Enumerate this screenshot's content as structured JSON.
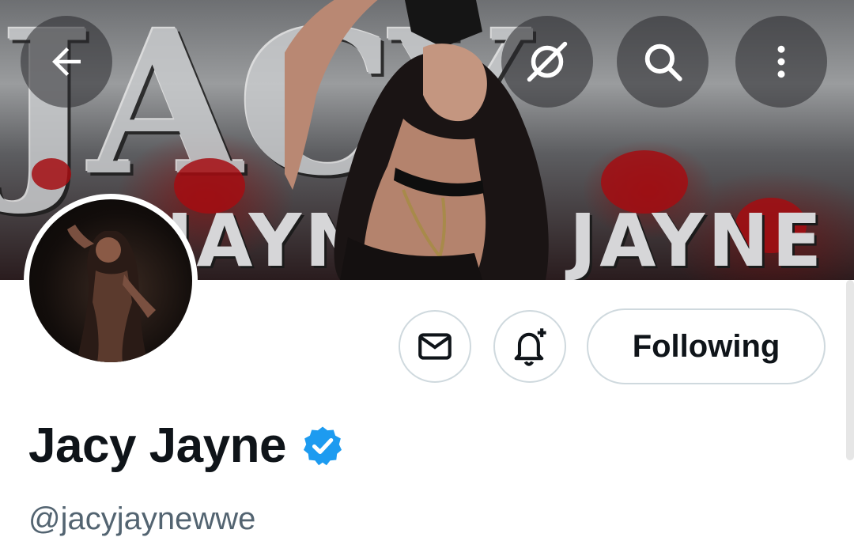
{
  "banner": {
    "letters": "JACY",
    "sub_left": "JAYNE",
    "sub_right": "JAYNE"
  },
  "topbar": {
    "back_icon": "arrow-left-icon",
    "grok_icon": "grok-icon",
    "search_icon": "search-icon",
    "more_icon": "more-vertical-icon"
  },
  "actions": {
    "message_icon": "envelope-icon",
    "notify_icon": "bell-plus-icon",
    "following_label": "Following"
  },
  "profile": {
    "display_name": "Jacy Jayne",
    "verified_icon": "verified-badge-icon",
    "handle": "@jacyjaynewwe"
  },
  "colors": {
    "text_primary": "#0f1419",
    "text_secondary": "#536471",
    "border": "#cfd9de",
    "verified": "#1d9bf0"
  }
}
